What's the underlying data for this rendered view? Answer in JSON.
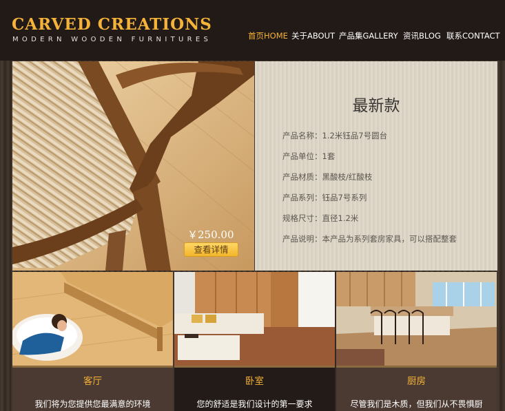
{
  "header": {
    "logo_title": "CARVED CREATIONS",
    "logo_subtitle": "MODERN WOODEN FURNITURES"
  },
  "nav": {
    "items": [
      {
        "label": "首页HOME",
        "active": true
      },
      {
        "label": "关于ABOUT",
        "active": false
      },
      {
        "label": "产品集GALLERY",
        "active": false
      },
      {
        "label": "资讯BLOG",
        "active": false
      },
      {
        "label": "联系CONTACT",
        "active": false
      }
    ]
  },
  "hero": {
    "price": "￥250.00",
    "detail_button": "查看详情"
  },
  "product": {
    "title": "最新款",
    "specs": [
      "产品名称：1.2米钰品7号圆台",
      "产品单位：1套",
      "产品材质：黑酸枝/红酸枝",
      "产品系列：钰品7号系列",
      "规格尺寸：直径1.2米",
      "产品说明：本产品为系列套房家具，可以搭配整套"
    ]
  },
  "rooms": [
    {
      "title": "客厅",
      "desc": "我们将为您提供您最满意的环境"
    },
    {
      "title": "卧室",
      "desc": "您的舒适是我们设计的第一要求"
    },
    {
      "title": "厨房",
      "desc": "尽管我们是木质，但我们从不畏惧厨"
    }
  ],
  "colors": {
    "accent": "#f5b33a",
    "header_bg": "#221a17",
    "panel_bg": "#dcd5c6",
    "footer_brown": "#4a3a32",
    "footer_dark": "#231b17"
  }
}
